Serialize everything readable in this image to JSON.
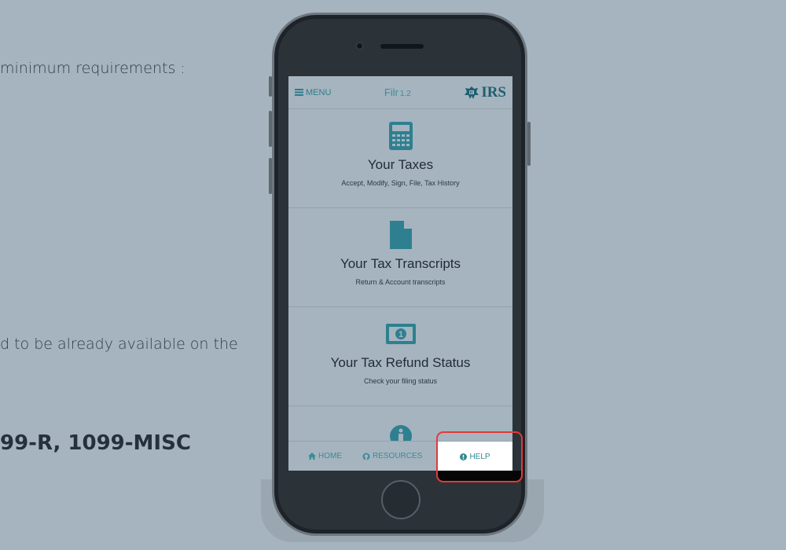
{
  "background_text": {
    "line1": "minimum requirements :",
    "line2": "d to be already available on the",
    "line3": "99-R, 1099-MISC"
  },
  "topbar": {
    "menu_label": "MENU",
    "menu_icon": "hamburger-icon",
    "app_title": "Filr",
    "app_version": "1.2",
    "logo_text": "IRS",
    "logo_icon": "irs-eagle-icon"
  },
  "tiles": [
    {
      "icon": "calculator-icon",
      "title": "Your Taxes",
      "subtitle": "Accept, Modify, Sign, File, Tax History"
    },
    {
      "icon": "document-icon",
      "title": "Your Tax Transcripts",
      "subtitle": "Return & Account transcripts"
    },
    {
      "icon": "money-icon",
      "title": "Your Tax Refund Status",
      "subtitle": "Check your filing status"
    },
    {
      "icon": "info-icon"
    }
  ],
  "bottom_nav": {
    "home_label": "HOME",
    "resources_label": "RESOURCES",
    "help_label": "HELP"
  },
  "colors": {
    "accent": "#3a8c96",
    "highlight": "#e23a3a",
    "icon": "#2e8090"
  }
}
